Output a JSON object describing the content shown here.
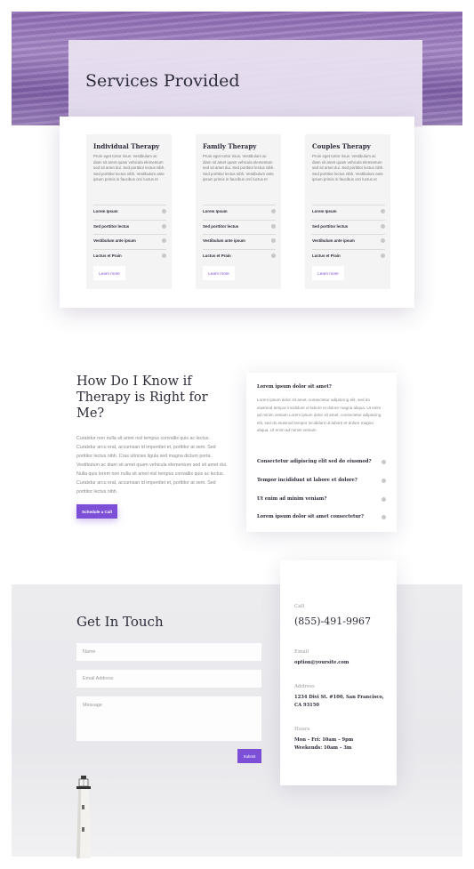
{
  "hero": {
    "title": "Services Provided"
  },
  "services": [
    {
      "title": "Individual Therapy",
      "description": "Proin eget tortor risus. Vestibulum ac diam sit amet quam vehicula elementum sed sit amet dui. Sed porttitor lectus nibh. Sed porttitor lectus nibh. Vestibulum ante ipsum primis in faucibus orci luctus et",
      "items": [
        "Lorem Ipsum",
        "Sed porttitor lectus",
        "Vestibulum ante ipsum",
        "Luctus et Prain"
      ],
      "button_label": "Learn more"
    },
    {
      "title": "Family Therapy",
      "description": "Proin eget tortor risus. Vestibulum ac diam sit amet quam vehicula elementum sed sit amet dui. Sed porttitor lectus nibh. Sed porttitor lectus nibh. Vestibulum ante ipsum primis in faucibus orci luctus et",
      "items": [
        "Lorem Ipsum",
        "Sed porttitor lectus",
        "Vestibulum ante ipsum",
        "Luctus et Prain"
      ],
      "button_label": "Learn more"
    },
    {
      "title": "Couples Therapy",
      "description": "Proin eget tortor risus. Vestibulum ac diam sit amet quam vehicula elementum sed sit amet dui. Sed porttitor lectus nibh. Sed porttitor lectus nibh. Vestibulum ante ipsum primis in faucibus orci luctus et",
      "items": [
        "Lorem Ipsum",
        "Sed porttitor lectus",
        "Vestibulum ante ipsum",
        "Luctus et Prain"
      ],
      "button_label": "Learn more"
    }
  ],
  "therapy": {
    "title": "How Do I Know if Therapy is Right for Me?",
    "body": "Curabitur non nulla sit amet nisl tempus convallis quis ac lectus. Curabitur arcu erat, accumsan id imperdiet et, porttitor at sem. Sed porttitor lectus nibh. Cras ultricies ligula sed magna dictum porta. Vestibulum ac diam sit amet quam vehicula elementum sed sit amet dui. Nulla quis lorem non nulla sit amet nisl tempus convallis quis ac lectus. Curabitur arcu erat, accumsan id imperdiet et, porttitor at sem. Sed porttitor lectus nibh.",
    "button_label": "Schedule a Call"
  },
  "faq": {
    "open_question": "Lorem ipsum dolor sit amet?",
    "open_answer": "Lorem ipsum dolor sit amet, consectetur adipiscing elit, sed do eiusmod tempor incididunt ut labore et dolore magna aliqua. Ut enim ad minim veniam Lorem ipsum dolor sit amet, consectetur adipiscing elit, sed do eiusmod tempor incididunt ut labore et dolore magna aliqua. Ut enim ad minim veniam",
    "items": [
      "Consectetur adipiscing elit sed do eiusmod?",
      "Tempor incididunt ut labore et dolore?",
      "Ut enim ad minim veniam?",
      "Lorem ipsum dolor sit amet consectetur?"
    ]
  },
  "contact": {
    "title": "Get In Touch",
    "name_placeholder": "Name",
    "email_placeholder": "Email Address",
    "message_placeholder": "Message",
    "submit_label": "Submit"
  },
  "info": {
    "call_label": "Call",
    "phone": "(855)-491-9967",
    "email_label": "Email",
    "email": "option@yoursite.com",
    "address_label": "Address",
    "address": "1234 Divi St. #100, San Francisco, CA 93150",
    "hours_label": "Hours",
    "hours_line1": "Mon – Fri: 10am – 9pm",
    "hours_line2": "Weekends: 10am – 3m"
  },
  "colors": {
    "accent": "#7d4fd6",
    "heading": "#2d2d3a",
    "hero_overlay": "#ebe4f2"
  }
}
